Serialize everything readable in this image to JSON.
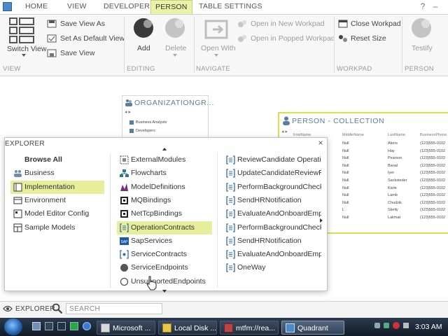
{
  "ribbon": {
    "tabs": [
      "HOME",
      "VIEW",
      "DEVELOPER",
      "PERSON",
      "TABLE SETTINGS"
    ],
    "active_tab": "PERSON",
    "help": "?",
    "groups": {
      "view": {
        "label": "VIEW",
        "switch_view": "Switch View",
        "save_view_as": "Save View As",
        "set_default": "Set As Default View",
        "save_view": "Save View"
      },
      "editing": {
        "label": "EDITING",
        "add": "Add",
        "delete": "Delete"
      },
      "navigate": {
        "label": "NAVIGATE",
        "open_with": "Open With",
        "open_new": "Open in New Workpad",
        "open_popped": "Open in Popped Workpad"
      },
      "workpad": {
        "label": "WORKPAD",
        "close": "Close Workpad",
        "reset": "Reset Size"
      },
      "person": {
        "label": "PERSON",
        "testify": "Testify"
      }
    }
  },
  "org_card": {
    "title": "ORGANIZATIONGR...",
    "items": [
      "Business Analysts",
      "Developers"
    ]
  },
  "person_card": {
    "title": "PERSON - COLLECTION",
    "columns": [
      "FirstName",
      "MiddleName",
      "LastName",
      "BusinessPhone"
    ],
    "rows": [
      [
        "",
        "Null",
        "Akers",
        "(123)555-0102"
      ],
      [
        "",
        "Null",
        "Hay",
        "(123)555-0102"
      ],
      [
        "",
        "Null",
        "Pearson",
        "(123)555-0102"
      ],
      [
        "",
        "Null",
        "Banal",
        "(123)555-0102"
      ],
      [
        "",
        "Null",
        "Iyer",
        "(123)555-0102"
      ],
      [
        "",
        "Null",
        "Sacksteder",
        "(123)555-0102"
      ],
      [
        "",
        "Null",
        "Karle",
        "(123)555-0102"
      ],
      [
        "",
        "Null",
        "Lamb",
        "(123)555-0102"
      ],
      [
        "",
        "Null",
        "Chudzik",
        "(123)555-0102"
      ],
      [
        "",
        "L",
        "Skelly",
        "(123)555-0102"
      ],
      [
        "",
        "Null",
        "Lakmat",
        "(123)555-0102"
      ]
    ]
  },
  "explorer": {
    "title": "EXPLORER",
    "close": "×",
    "col1": [
      {
        "label": "Browse All",
        "icon": "none",
        "bold": true
      },
      {
        "label": "Business",
        "icon": "people-icon"
      },
      {
        "label": "Implementation",
        "icon": "folder-icon",
        "selected": true
      },
      {
        "label": "Environment",
        "icon": "gear-icon"
      },
      {
        "label": "Model Editor Config",
        "icon": "config-icon"
      },
      {
        "label": "Sample Models",
        "icon": "models-icon"
      }
    ],
    "col2": [
      {
        "label": "ExternalModules",
        "icon": "module-icon"
      },
      {
        "label": "Flowcharts",
        "icon": "flowchart-icon"
      },
      {
        "label": "ModelDefinitions",
        "icon": "model-def-icon"
      },
      {
        "label": "MQBindings",
        "icon": "binding-icon"
      },
      {
        "label": "NetTcpBindings",
        "icon": "binding-icon"
      },
      {
        "label": "OperationContracts",
        "icon": "contract-icon",
        "selected": true
      },
      {
        "label": "SapServices",
        "icon": "sap-icon",
        "icon_text": "SAP"
      },
      {
        "label": "ServiceContracts",
        "icon": "service-icon"
      },
      {
        "label": "ServiceEndpoints",
        "icon": "endpoint-icon"
      },
      {
        "label": "UnsupportedEndpoints",
        "icon": "unsupported-icon",
        "shown": "Uns   edEndpoints"
      }
    ],
    "col3": [
      "ReviewCandidate Operation",
      "UpdateCandidateReviewRes",
      "PerformBackgroundCheck",
      "SendHRNotification",
      "EvaluateAndOnboardEmplo",
      "PerformBackgroundCheck",
      "SendHRNotification",
      "EvaluateAndOnboardEmplo",
      "OneWay"
    ]
  },
  "bottom": {
    "explorer_label": "EXPLORER",
    "search_placeholder": "SEARCH"
  },
  "taskbar": {
    "items": [
      "Microsoft ...",
      "Local Disk ...",
      "mtfm://rea...",
      "Quadrant"
    ],
    "active": "Quadrant",
    "clock": "3:03 AM"
  },
  "colors": {
    "accent": "#e6ee9c",
    "selection_border": "#d8e24a",
    "title_blue": "#5b7c9e"
  }
}
